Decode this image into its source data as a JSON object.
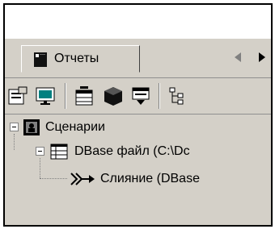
{
  "panel": {
    "tab_label": "Отчеты",
    "tab_icon": "report-book-icon"
  },
  "toolbar": {
    "buttons": [
      {
        "name": "properties-icon"
      },
      {
        "name": "preview-monitor-icon"
      },
      {
        "name": "table-icon"
      },
      {
        "name": "cube-icon"
      },
      {
        "name": "report-export-icon"
      },
      {
        "name": "tree-structure-icon"
      }
    ]
  },
  "tree": {
    "root": {
      "label": "Сценарии",
      "icon": "scenario-icon"
    },
    "child": {
      "label": "DBase файл (C:\\Dc",
      "icon": "grid-table-icon"
    },
    "leaf": {
      "label": "Слияние (DBase",
      "icon": "merge-arrow-icon"
    }
  },
  "colors": {
    "panel_bg": "#d4d0c8",
    "border": "#000000"
  }
}
